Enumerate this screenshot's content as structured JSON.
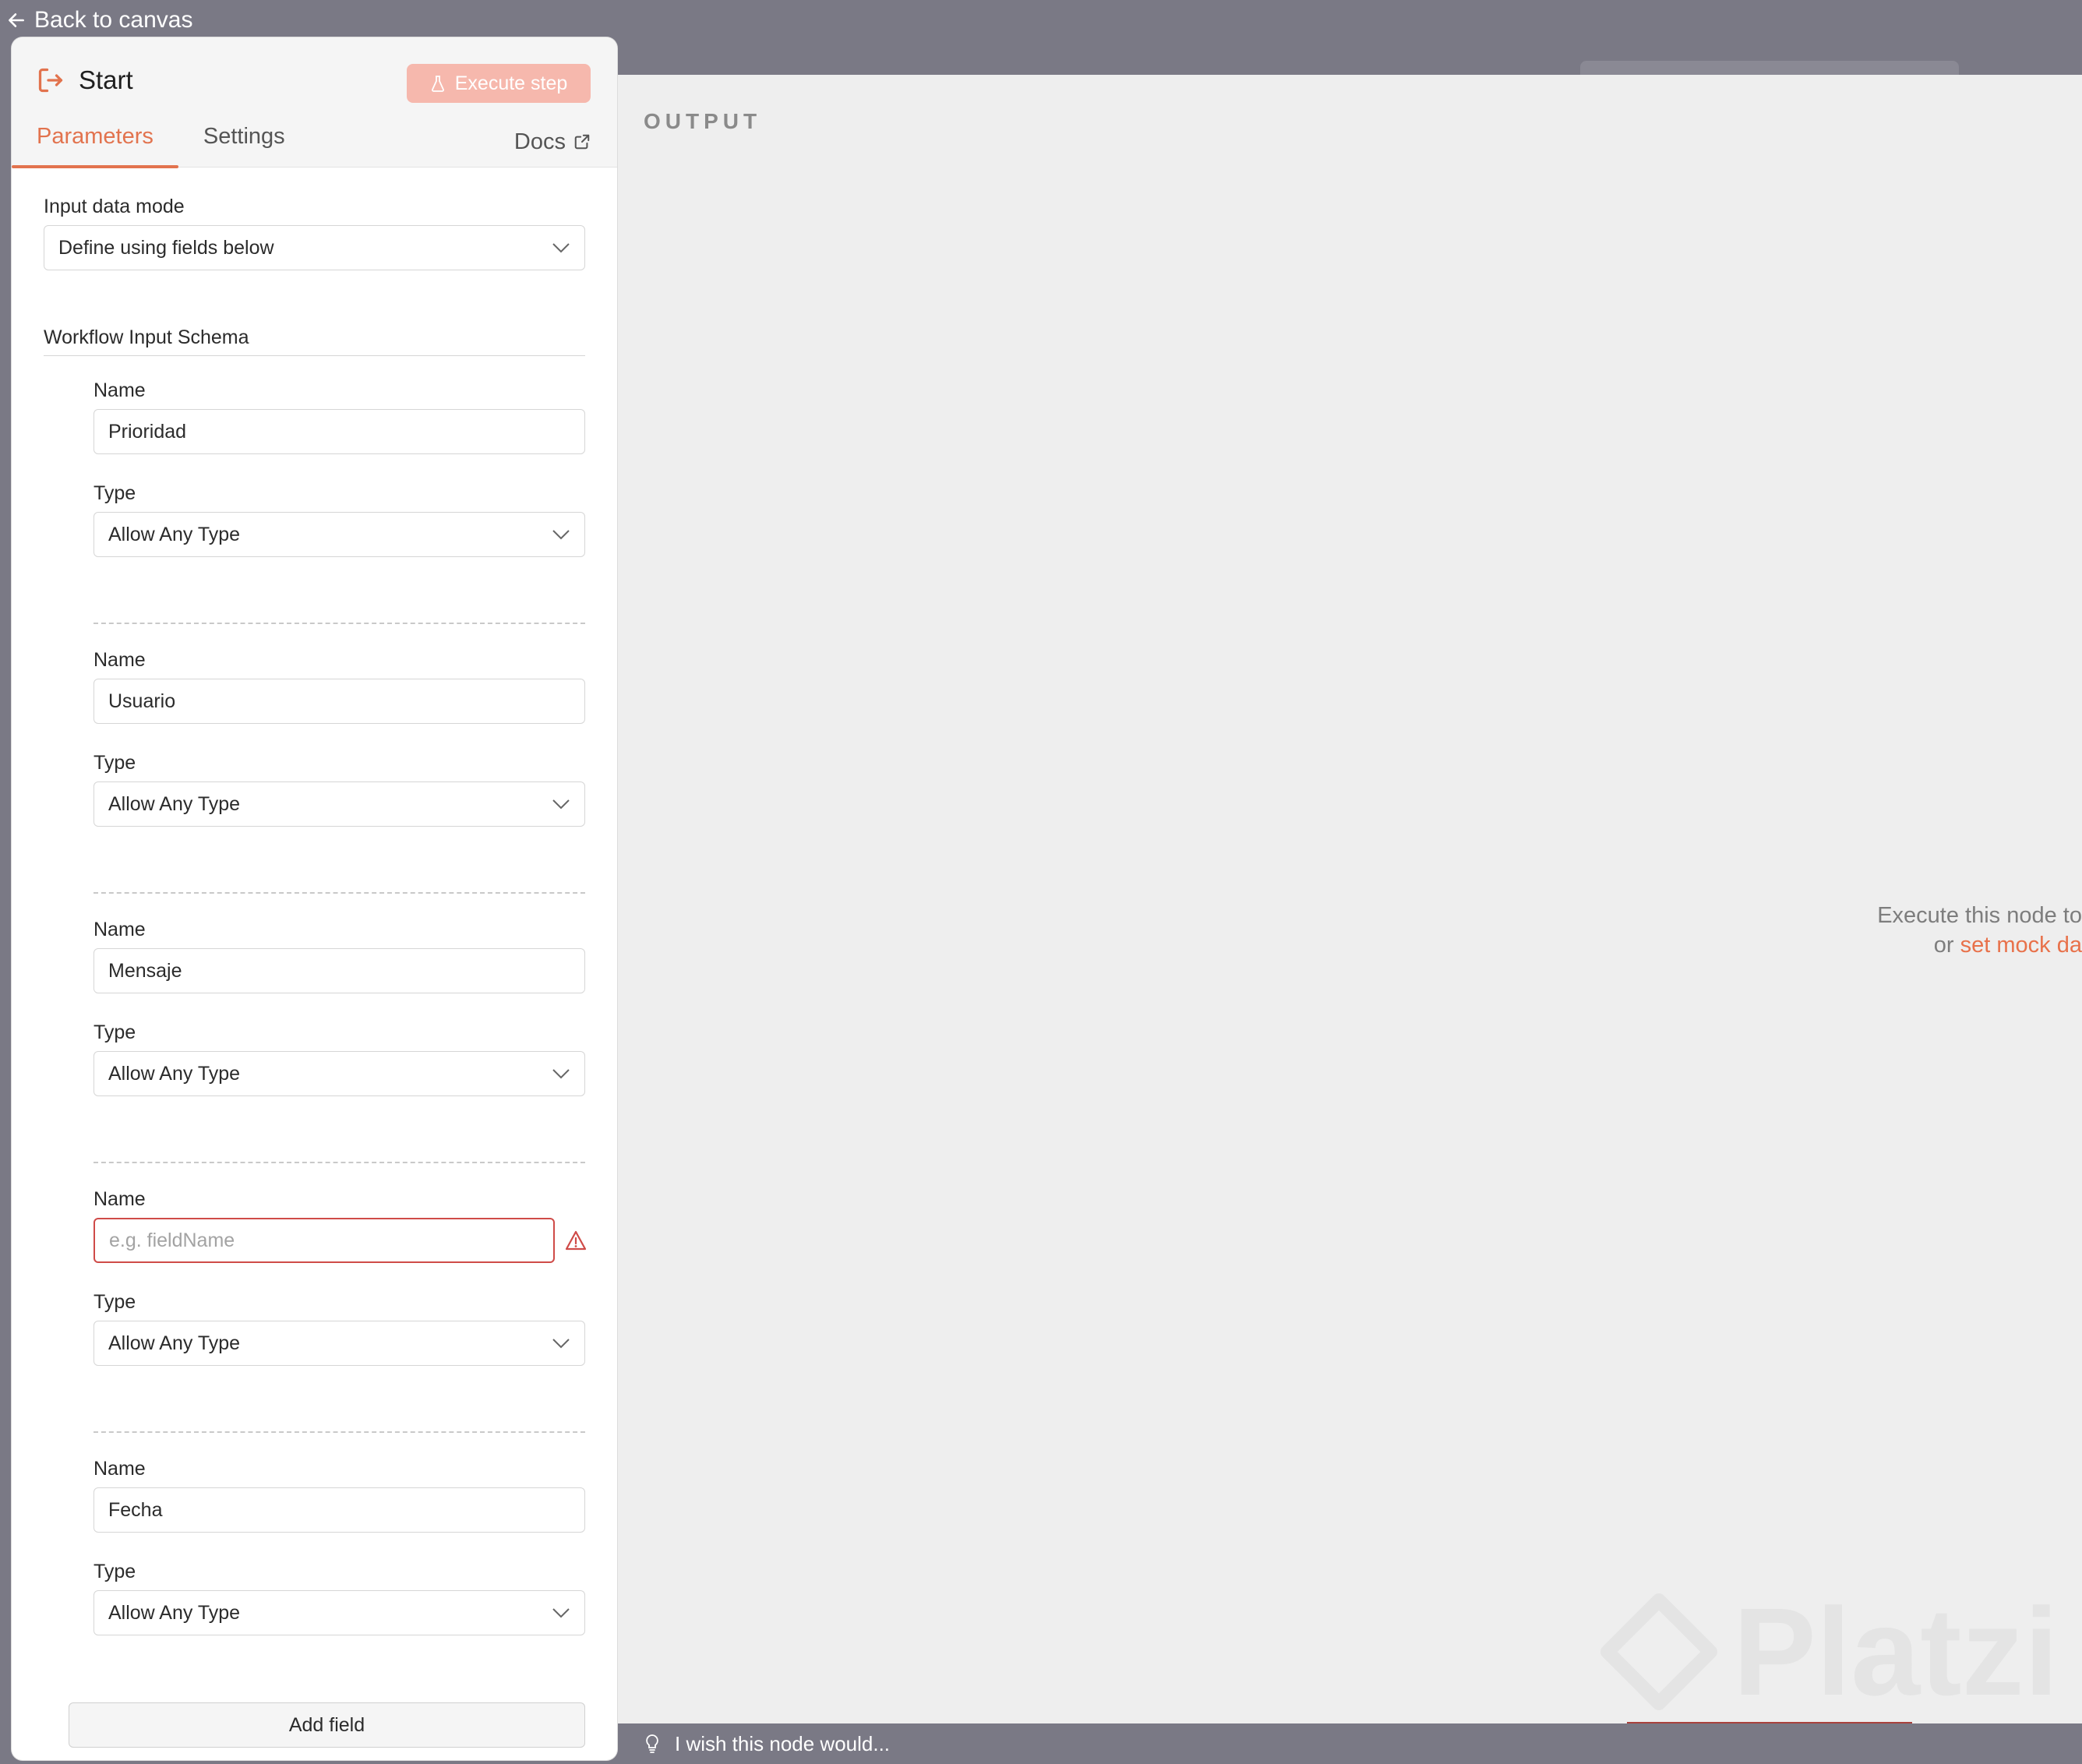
{
  "nav": {
    "back_label": "Back to canvas"
  },
  "node": {
    "title": "Start",
    "execute_label": "Execute step"
  },
  "tabs": {
    "parameters": "Parameters",
    "settings": "Settings",
    "docs": "Docs"
  },
  "params": {
    "input_mode_label": "Input data mode",
    "input_mode_value": "Define using fields below",
    "schema_title": "Workflow Input Schema",
    "fields": [
      {
        "name_label": "Name",
        "name_value": "Prioridad",
        "type_label": "Type",
        "type_value": "Allow Any Type"
      },
      {
        "name_label": "Name",
        "name_value": "Usuario",
        "type_label": "Type",
        "type_value": "Allow Any Type"
      },
      {
        "name_label": "Name",
        "name_value": "Mensaje",
        "type_label": "Type",
        "type_value": "Allow Any Type"
      },
      {
        "name_label": "Name",
        "name_value": "",
        "name_placeholder": "e.g. fieldName",
        "type_label": "Type",
        "type_value": "Allow Any Type"
      },
      {
        "name_label": "Name",
        "name_value": "Fecha",
        "type_label": "Type",
        "type_value": "Allow Any Type"
      }
    ],
    "add_field_label": "Add field"
  },
  "output": {
    "title": "OUTPUT",
    "hint_line1": "Execute this node to",
    "hint_or": "or",
    "hint_link": "set mock da"
  },
  "feedback": {
    "text": "I wish this node would..."
  },
  "watermark": {
    "text": "Platzi"
  },
  "colors": {
    "accent": "#e2734e",
    "error": "#cf4b48",
    "execute_disabled": "#f6b8ad"
  }
}
